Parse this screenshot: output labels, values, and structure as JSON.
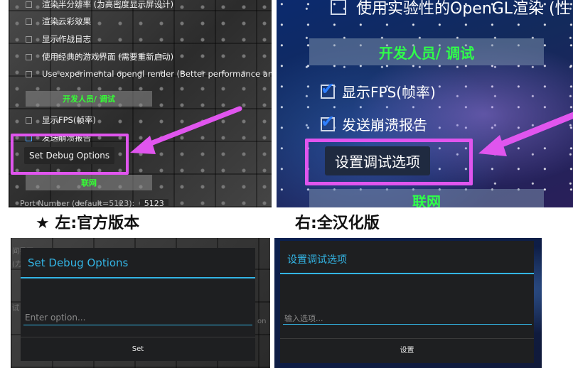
{
  "official_settings": {
    "options": [
      {
        "label": "渲染半分辨率 (为高密度显示屏设计)",
        "checked": false
      },
      {
        "label": "渲染云彩效果",
        "checked": false
      },
      {
        "label": "显示作战日志",
        "checked": false
      },
      {
        "label": "使用经典的游戏界面 (需要重新启动)",
        "checked": false
      },
      {
        "label": "Use experimental opengl render (Better performance and",
        "checked": false
      }
    ],
    "category": "开发人员/ 调试",
    "show_fps": "显示FPS(帧率)",
    "crash_report": "发送崩溃报告",
    "set_debug_button": "Set Debug Options",
    "network_category": "联网",
    "port_label": "Port Number (default=5123):",
    "port_value": "5123"
  },
  "chinese_settings": {
    "opengl_option": "使用实验性的OpenGL渲染 (性",
    "category": "开发人员/ 调试",
    "show_fps": "显示FPS(帧率)",
    "crash_report": "发送崩溃报告",
    "set_debug_button": "设置调试选项",
    "network_category": "联网"
  },
  "captions": {
    "left": "★ 左:官方版本",
    "right": "右:全汉化版"
  },
  "official_dialog": {
    "title": "Set Debug Options",
    "placeholder": "Enter option...",
    "button": "Set",
    "background_fragments": [
      "间界面)",
      "(力",
      "试",
      "on"
    ]
  },
  "chinese_dialog": {
    "title": "设置调试选项",
    "placeholder": "输入选项...",
    "button": "设置"
  },
  "colors": {
    "highlight": "#e055ee",
    "holo_blue": "#33b5e5",
    "category_green": "#34ff34"
  }
}
